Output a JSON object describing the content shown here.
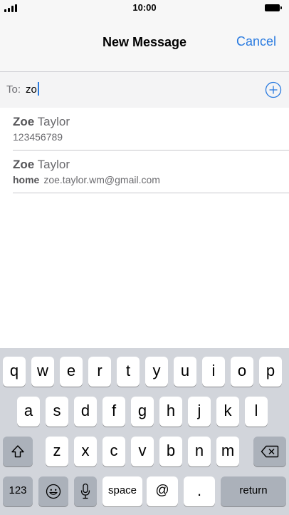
{
  "status_bar": {
    "time": "10:00"
  },
  "nav": {
    "title": "New Message",
    "cancel_label": "Cancel"
  },
  "to_field": {
    "label": "To:",
    "value": "zo"
  },
  "suggestions": [
    {
      "name_bold": "Zoe",
      "name_rest": " Taylor",
      "detail_label": "",
      "detail_value": "123456789"
    },
    {
      "name_bold": "Zoe",
      "name_rest": " Taylor",
      "detail_label": "home",
      "detail_value": "zoe.taylor.wm@gmail.com"
    }
  ],
  "keyboard": {
    "row1": [
      "q",
      "w",
      "e",
      "r",
      "t",
      "y",
      "u",
      "i",
      "o",
      "p"
    ],
    "row2": [
      "a",
      "s",
      "d",
      "f",
      "g",
      "h",
      "j",
      "k",
      "l"
    ],
    "row3": [
      "z",
      "x",
      "c",
      "v",
      "b",
      "n",
      "m"
    ],
    "numbers_label": "123",
    "space_label": "space",
    "at_label": "@",
    "period_label": ".",
    "return_label": "return"
  },
  "colors": {
    "accent": "#2a7be0",
    "keyboard_bg": "#d2d5db",
    "special_key": "#abb1ba"
  },
  "icons": {
    "add_contact": "plus-circle-icon",
    "shift": "shift-arrow-icon",
    "delete": "backspace-icon",
    "emoji": "smiley-icon",
    "dictation": "microphone-icon"
  }
}
